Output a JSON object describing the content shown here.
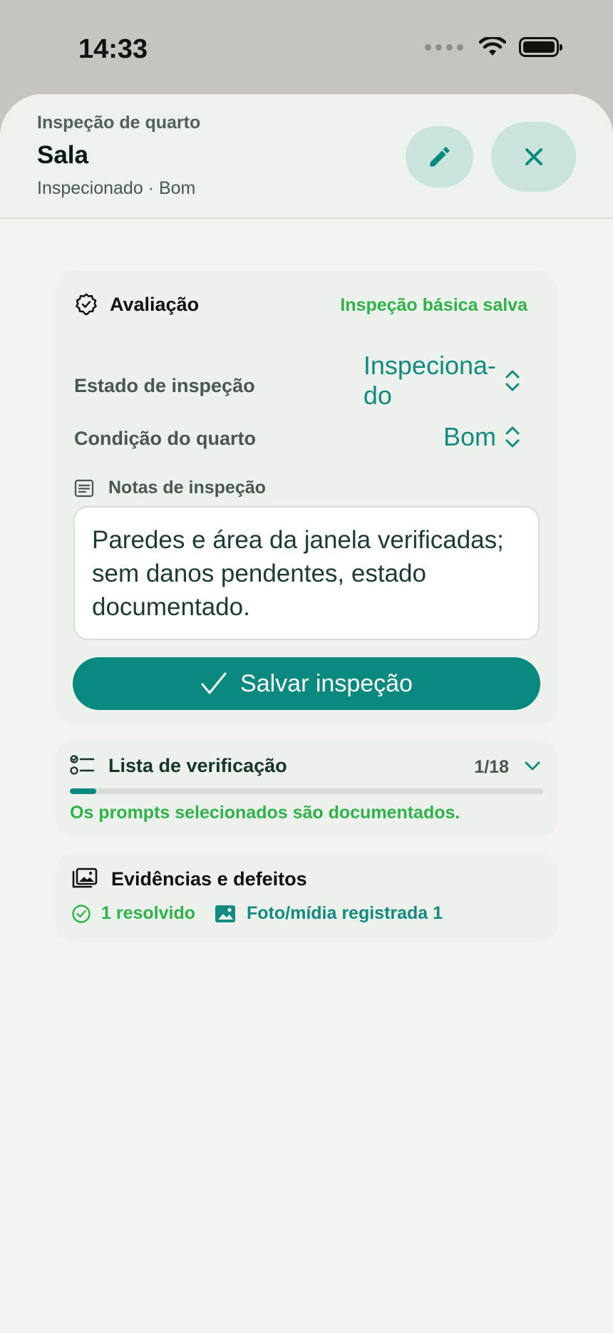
{
  "status_bar": {
    "time": "14:33"
  },
  "header": {
    "eyebrow": "Inspeção de quarto",
    "title": "Sala",
    "subtitle": "Inspecionado · Bom"
  },
  "evaluation": {
    "title": "Avaliação",
    "saved_status": "Inspeção básica salva",
    "inspection_state_label": "Estado de inspeção",
    "inspection_state_value_line1": "Inspeciona-",
    "inspection_state_value_line2": "do",
    "room_condition_label": "Condição do quarto",
    "room_condition_value": "Bom",
    "notes_label": "Notas de inspeção",
    "notes_text": "Paredes e área da janela verificadas; sem danos pendentes, estado documentado.",
    "save_button": "Salvar inspeção"
  },
  "checklist": {
    "title": "Lista de verificação",
    "count": "1/18",
    "progress_fraction": 0.0556,
    "caption": "Os prompts selecionados são documentados."
  },
  "evidence": {
    "title": "Evidências e defeitos",
    "resolved": "1 resolvido",
    "media": "Foto/mídia registrada 1"
  },
  "colors": {
    "accent": "#0a8a7f",
    "success": "#2fb24a",
    "button_tint": "#c9e4dd",
    "sheet_bg": "#f4f3ef"
  }
}
